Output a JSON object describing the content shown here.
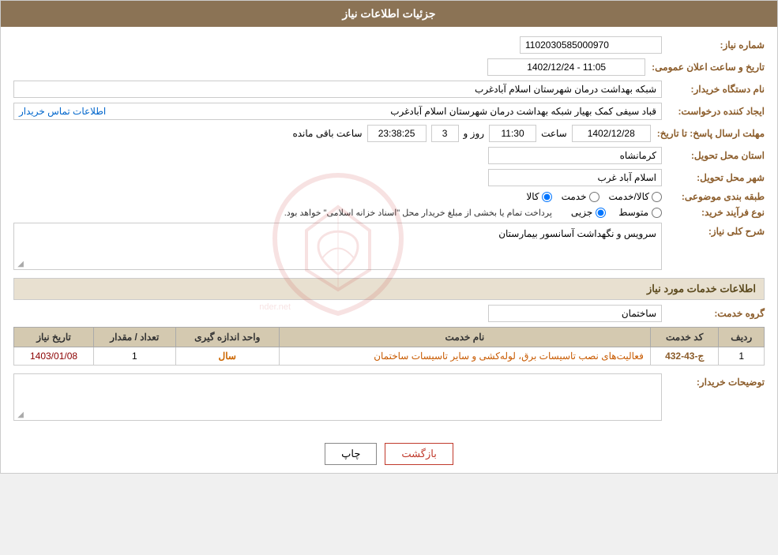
{
  "page": {
    "title": "جزئیات اطلاعات نیاز",
    "header_bg": "#8b7355"
  },
  "fields": {
    "need_number_label": "شماره نیاز:",
    "need_number_value": "1102030585000970",
    "buyer_org_label": "نام دستگاه خریدار:",
    "buyer_org_value": "شبکه بهداشت درمان شهرستان اسلام آبادغرب",
    "creator_label": "ایجاد کننده درخواست:",
    "creator_value": "قباد سیفی کمک بهیار شبکه بهداشت درمان شهرستان اسلام آبادغرب",
    "contact_link": "اطلاعات تماس خریدار",
    "deadline_label": "مهلت ارسال پاسخ: تا تاریخ:",
    "deadline_date": "1402/12/28",
    "deadline_time_label": "ساعت",
    "deadline_time": "11:30",
    "deadline_day_label": "روز و",
    "deadline_days": "3",
    "deadline_remaining_label": "ساعت باقی مانده",
    "deadline_remaining": "23:38:25",
    "province_label": "استان محل تحویل:",
    "province_value": "کرمانشاه",
    "city_label": "شهر محل تحویل:",
    "city_value": "اسلام آباد غرب",
    "category_label": "طبقه بندی موضوعی:",
    "category_kala": "کالا",
    "category_khadamat": "خدمت",
    "category_kala_khadamat": "کالا/خدمت",
    "purchase_type_label": "نوع فرآیند خرید:",
    "purchase_jozii": "جزیی",
    "purchase_motavasset": "متوسط",
    "purchase_notice": "پرداخت تمام یا بخشی از مبلغ خریدار محل \"اسناد خزانه اسلامی\" خواهد بود.",
    "description_label": "شرح کلی نیاز:",
    "description_value": "سرویس و نگهداشت آسانسور بیمارستان",
    "services_section_label": "اطلاعات خدمات مورد نیاز",
    "service_group_label": "گروه خدمت:",
    "service_group_value": "ساختمان",
    "table_headers": {
      "row_num": "ردیف",
      "service_code": "کد خدمت",
      "service_name": "نام خدمت",
      "unit": "واحد اندازه گیری",
      "quantity": "تعداد / مقدار",
      "date": "تاریخ نیاز"
    },
    "table_rows": [
      {
        "row": "1",
        "code": "ج-43-432",
        "name": "فعالیت‌های نصب تاسیسات برق، لوله‌کشی و سایر تاسیسات ساختمان",
        "unit": "سال",
        "quantity": "1",
        "date": "1403/01/08"
      }
    ],
    "buyer_notes_label": "توضیحات خریدار:"
  },
  "buttons": {
    "print": "چاپ",
    "back": "بازگشت"
  }
}
